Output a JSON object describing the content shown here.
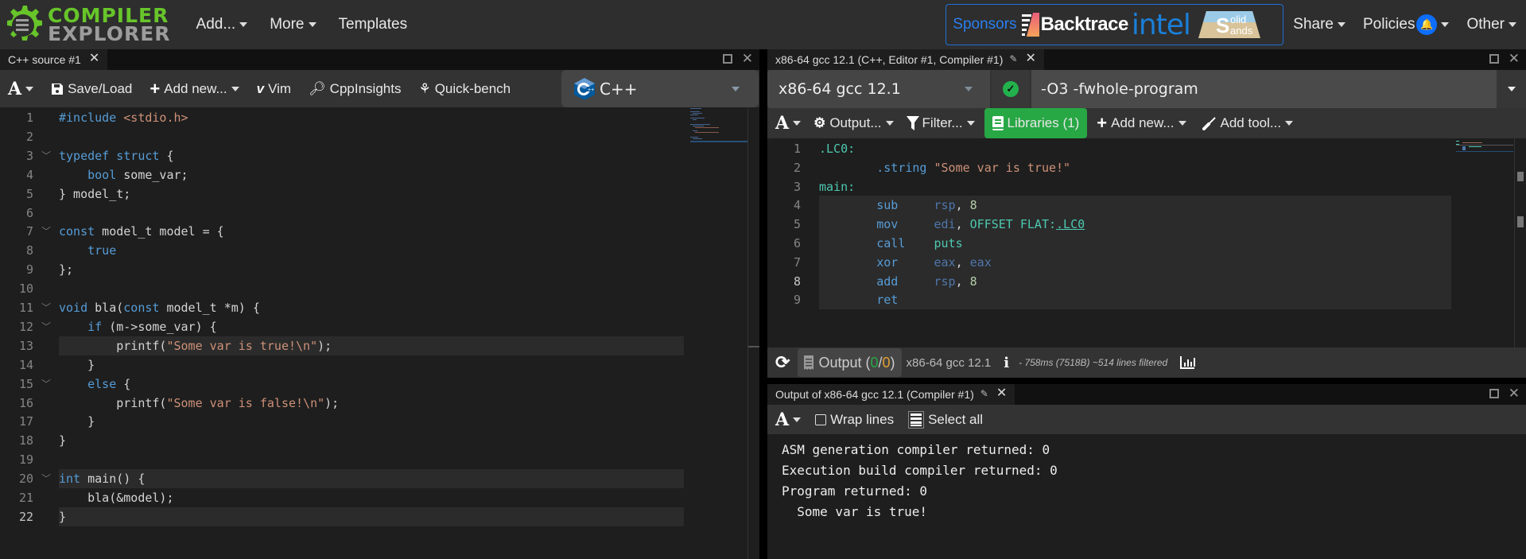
{
  "navbar": {
    "logo": {
      "line1": "COMPILER",
      "line2": "EXPLORER"
    },
    "menu": [
      {
        "label": "Add...",
        "dropdown": true
      },
      {
        "label": "More",
        "dropdown": true
      },
      {
        "label": "Templates",
        "dropdown": false
      }
    ],
    "sponsors": {
      "label": "Sponsors",
      "items": [
        "Backtrace",
        "intel",
        "Solid Sands"
      ],
      "solid_line1": "olid",
      "solid_line2": "ands",
      "solid_initial": "S"
    },
    "right_menu": [
      {
        "label": "Share",
        "dropdown": true
      },
      {
        "label": "Policies",
        "dropdown": true,
        "badge_icon": "bell-icon"
      },
      {
        "label": "Other",
        "dropdown": true
      }
    ]
  },
  "source_pane": {
    "tab_title": "C++ source #1",
    "toolbar": {
      "font_button": "A",
      "save_load": "Save/Load",
      "add_new": "Add new...",
      "vim": "Vim",
      "cppinsights": "CppInsights",
      "quickbench": "Quick-bench"
    },
    "language": "C++",
    "current_line": 22,
    "lines": [
      {
        "n": 1,
        "tokens": [
          [
            "kw",
            "#include "
          ],
          [
            "str",
            "<stdio.h>"
          ]
        ]
      },
      {
        "n": 2,
        "tokens": []
      },
      {
        "n": 3,
        "fold": true,
        "tokens": [
          [
            "kw",
            "typedef struct"
          ],
          [
            "",
            " {"
          ]
        ]
      },
      {
        "n": 4,
        "tokens": [
          [
            "",
            "    "
          ],
          [
            "kw",
            "bool"
          ],
          [
            "",
            " some_var;"
          ]
        ]
      },
      {
        "n": 5,
        "tokens": [
          [
            "",
            "} model_t;"
          ]
        ]
      },
      {
        "n": 6,
        "tokens": []
      },
      {
        "n": 7,
        "fold": true,
        "tokens": [
          [
            "kw",
            "const"
          ],
          [
            "",
            " model_t model = {"
          ]
        ]
      },
      {
        "n": 8,
        "tokens": [
          [
            "",
            "    "
          ],
          [
            "kw",
            "true"
          ]
        ]
      },
      {
        "n": 9,
        "tokens": [
          [
            "",
            "};"
          ]
        ]
      },
      {
        "n": 10,
        "tokens": []
      },
      {
        "n": 11,
        "fold": true,
        "tokens": [
          [
            "kw",
            "void"
          ],
          [
            "",
            " bla("
          ],
          [
            "kw",
            "const"
          ],
          [
            "",
            " model_t *m) {"
          ]
        ]
      },
      {
        "n": 12,
        "fold": true,
        "tokens": [
          [
            "",
            "    "
          ],
          [
            "kw",
            "if"
          ],
          [
            "",
            " (m->some_var) {"
          ]
        ]
      },
      {
        "n": 13,
        "highlight": true,
        "tokens": [
          [
            "",
            "        printf("
          ],
          [
            "str",
            "\"Some var is true!\\n\""
          ],
          [
            "",
            ");"
          ]
        ]
      },
      {
        "n": 14,
        "tokens": [
          [
            "",
            "    }"
          ]
        ]
      },
      {
        "n": 15,
        "fold": true,
        "tokens": [
          [
            "",
            "    "
          ],
          [
            "kw",
            "else"
          ],
          [
            "",
            " {"
          ]
        ]
      },
      {
        "n": 16,
        "tokens": [
          [
            "",
            "        printf("
          ],
          [
            "str",
            "\"Some var is false!\\n\""
          ],
          [
            "",
            ");"
          ]
        ]
      },
      {
        "n": 17,
        "tokens": [
          [
            "",
            "    }"
          ]
        ]
      },
      {
        "n": 18,
        "tokens": [
          [
            "",
            "}"
          ]
        ]
      },
      {
        "n": 19,
        "tokens": []
      },
      {
        "n": 20,
        "fold": true,
        "highlight": true,
        "tokens": [
          [
            "kw",
            "int"
          ],
          [
            "",
            " main() {"
          ]
        ]
      },
      {
        "n": 21,
        "tokens": [
          [
            "",
            "    bla(&model);"
          ]
        ]
      },
      {
        "n": 22,
        "highlight": true,
        "tokens": [
          [
            "",
            "}"
          ]
        ]
      }
    ]
  },
  "compiler_pane": {
    "tab_title": "x86-64 gcc 12.1 (C++, Editor #1, Compiler #1)",
    "compiler": "x86-64 gcc 12.1",
    "options": "-O3 -fwhole-program",
    "toolbar": {
      "font_button": "A",
      "output": "Output...",
      "filter": "Filter...",
      "libraries": "Libraries (1)",
      "add_new": "Add new...",
      "add_tool": "Add tool..."
    },
    "current_line": 8,
    "asm_lines": [
      {
        "n": 1,
        "tokens": [
          [
            "lbl",
            ".LC0:"
          ]
        ]
      },
      {
        "n": 2,
        "tokens": [
          [
            "",
            "        "
          ],
          [
            "ins",
            ".string"
          ],
          [
            "",
            " "
          ],
          [
            "str",
            "\"Some var is true!\""
          ]
        ]
      },
      {
        "n": 3,
        "tokens": [
          [
            "lbl",
            "main:"
          ]
        ]
      },
      {
        "n": 4,
        "highlight": true,
        "tokens": [
          [
            "",
            "        "
          ],
          [
            "ins",
            "sub"
          ],
          [
            "",
            "     "
          ],
          [
            "reg",
            "rsp"
          ],
          [
            "",
            ", "
          ],
          [
            "num",
            "8"
          ]
        ]
      },
      {
        "n": 5,
        "highlight": true,
        "tokens": [
          [
            "",
            "        "
          ],
          [
            "ins",
            "mov"
          ],
          [
            "",
            "     "
          ],
          [
            "reg",
            "edi"
          ],
          [
            "",
            ", "
          ],
          [
            "lbl",
            "OFFSET FLAT:"
          ],
          [
            "link",
            ".LC0"
          ]
        ]
      },
      {
        "n": 6,
        "highlight": true,
        "tokens": [
          [
            "",
            "        "
          ],
          [
            "ins",
            "call"
          ],
          [
            "",
            "    "
          ],
          [
            "lbl",
            "puts"
          ]
        ]
      },
      {
        "n": 7,
        "highlight": true,
        "tokens": [
          [
            "",
            "        "
          ],
          [
            "ins",
            "xor"
          ],
          [
            "",
            "     "
          ],
          [
            "reg",
            "eax"
          ],
          [
            "",
            ", "
          ],
          [
            "reg",
            "eax"
          ]
        ]
      },
      {
        "n": 8,
        "highlight": true,
        "tokens": [
          [
            "",
            "        "
          ],
          [
            "ins",
            "add"
          ],
          [
            "",
            "     "
          ],
          [
            "reg",
            "rsp"
          ],
          [
            "",
            ", "
          ],
          [
            "num",
            "8"
          ]
        ]
      },
      {
        "n": 9,
        "highlight": true,
        "tokens": [
          [
            "",
            "        "
          ],
          [
            "ins",
            "ret"
          ]
        ]
      }
    ],
    "status": {
      "output_label": "Output (",
      "warnings": "0",
      "sep": "/",
      "errors": "0",
      "close": ")",
      "compiler": "x86-64 gcc 12.1",
      "timing": "- 758ms (7518B) ~514 lines filtered"
    }
  },
  "output_pane": {
    "tab_title": "Output of x86-64 gcc 12.1 (Compiler #1)",
    "toolbar": {
      "font_button": "A",
      "wrap_lines": "Wrap lines",
      "wrap_checked": false,
      "select_all": "Select all"
    },
    "lines": [
      "ASM generation compiler returned: 0",
      "Execution build compiler returned: 0",
      "Program returned: 0",
      "  Some var is true!"
    ]
  },
  "colors": {
    "brand_green": "#67c52a",
    "libraries_green": "#28a745",
    "sponsor_blue": "#1f6fd6",
    "bell_blue": "#0d6efd"
  }
}
